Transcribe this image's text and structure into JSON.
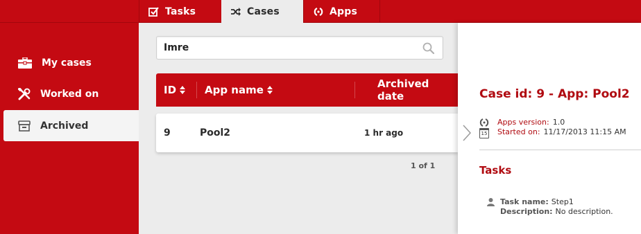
{
  "tabs": [
    {
      "label": "Tasks",
      "icon": "checkbox-icon"
    },
    {
      "label": "Cases",
      "icon": "shuffle-icon",
      "active": true
    },
    {
      "label": "Apps",
      "icon": "apps-icon"
    }
  ],
  "sidebar": {
    "items": [
      {
        "label": "My cases",
        "icon": "briefcase-icon"
      },
      {
        "label": "Worked on",
        "icon": "tools-icon"
      },
      {
        "label": "Archived",
        "icon": "archive-icon",
        "active": true
      }
    ]
  },
  "search": {
    "value": "Imre",
    "icon": "search-icon"
  },
  "table": {
    "columns": [
      "ID",
      "App name",
      "Archived date"
    ],
    "rows": [
      {
        "id": "9",
        "app_name": "Pool2",
        "archived_date": "1 hr ago"
      }
    ],
    "pager": "1 of 1"
  },
  "detail": {
    "title": "Case id: 9 - App: Pool2",
    "apps_version_label": "Apps version:",
    "apps_version_value": "1.0",
    "started_on_label": "Started on:",
    "started_on_value": "11/17/2013 11:15 AM",
    "calendar_day": "15",
    "tasks_heading": "Tasks",
    "task": {
      "name_label": "Task name:",
      "name_value": "Step1",
      "description_label": "Description:",
      "description_value": "No description."
    }
  },
  "colors": {
    "brand": "#c40a12",
    "accent_text": "#b00a10",
    "background": "#ececec"
  }
}
